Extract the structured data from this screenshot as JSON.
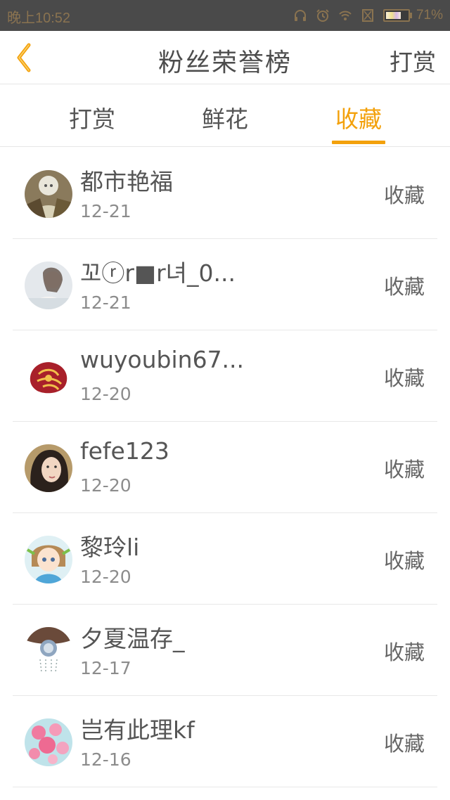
{
  "status_bar": {
    "time": "晚上10:52",
    "battery": "71%",
    "battery_level": 0.71,
    "icons": [
      "headphones-icon",
      "alarm-icon",
      "wifi-icon",
      "no-sim-icon",
      "battery-icon"
    ]
  },
  "header": {
    "title": "粉丝荣誉榜",
    "action_label": "打赏",
    "back_icon": "chevron-left-icon",
    "back_color": "#f3a10c"
  },
  "tabs": [
    {
      "label": "打赏",
      "active": false
    },
    {
      "label": "鲜花",
      "active": false
    },
    {
      "label": "收藏",
      "active": true
    }
  ],
  "accent_color": "#f3a10c",
  "fans": [
    {
      "name": "都市艳福",
      "date": "12-21",
      "action": "收藏"
    },
    {
      "name": "꼬ⓡr■r녀_0...",
      "date": "12-21",
      "action": "收藏"
    },
    {
      "name": "wuyoubin67...",
      "date": "12-20",
      "action": "收藏"
    },
    {
      "name": "fefe123",
      "date": "12-20",
      "action": "收藏"
    },
    {
      "name": "黎玲li",
      "date": "12-20",
      "action": "收藏"
    },
    {
      "name": "夕夏温存_",
      "date": "12-17",
      "action": "收藏"
    },
    {
      "name": "岂有此理kf",
      "date": "12-16",
      "action": "收藏"
    }
  ]
}
